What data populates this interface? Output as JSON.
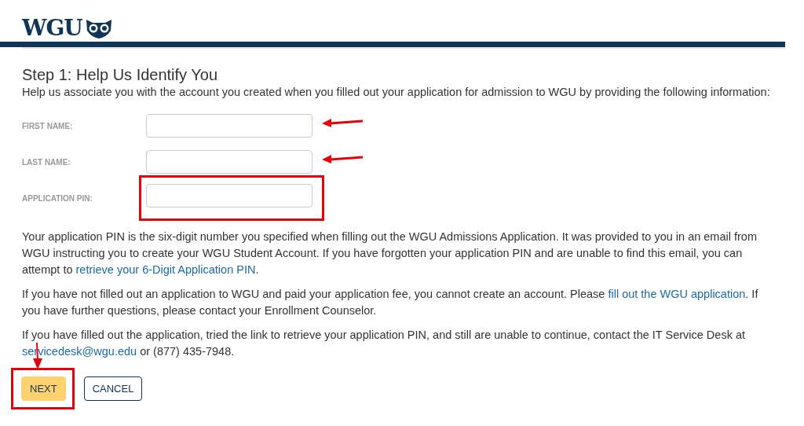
{
  "header": {
    "logo_text": "WGU"
  },
  "heading": "Step 1: Help Us Identify You",
  "intro": "Help us associate you with the account you created when you filled out your application for admission to WGU by providing the following information:",
  "fields": [
    {
      "label": "FIRST NAME:",
      "arrowed": true,
      "boxed": false
    },
    {
      "label": "LAST NAME:",
      "arrowed": true,
      "boxed": false
    },
    {
      "label": "APPLICATION PIN:",
      "arrowed": false,
      "boxed": true
    }
  ],
  "paragraphs": [
    {
      "parts": [
        {
          "text": "Your application PIN is the six-digit number you specified when filling out the WGU Admissions Application. It was provided to you in an email from WGU instructing you to create your WGU Student Account. If you have forgotten your application PIN and are unable to find this email, you can attempt to ",
          "link": false
        },
        {
          "text": "retrieve your 6-Digit Application PIN",
          "link": true
        },
        {
          "text": ".",
          "link": false
        }
      ]
    },
    {
      "parts": [
        {
          "text": "If you have not filled out an application to WGU and paid your application fee, you cannot create an account. Please ",
          "link": false
        },
        {
          "text": "fill out the WGU application",
          "link": true
        },
        {
          "text": ". If you have further questions, please contact your Enrollment Counselor.",
          "link": false
        }
      ]
    },
    {
      "parts": [
        {
          "text": "If you have filled out the application, tried the link to retrieve your application PIN, and still are unable to continue, contact the IT Service Desk at ",
          "link": false
        },
        {
          "text": "servicedesk@wgu.edu",
          "link": true
        },
        {
          "text": " or (877) 435-7948.",
          "link": false
        }
      ]
    }
  ],
  "buttons": [
    {
      "label": "NEXT",
      "kind": "primary",
      "arrowed": true,
      "boxed": true
    },
    {
      "label": "CANCEL",
      "kind": "secondary",
      "arrowed": false,
      "boxed": false
    }
  ]
}
